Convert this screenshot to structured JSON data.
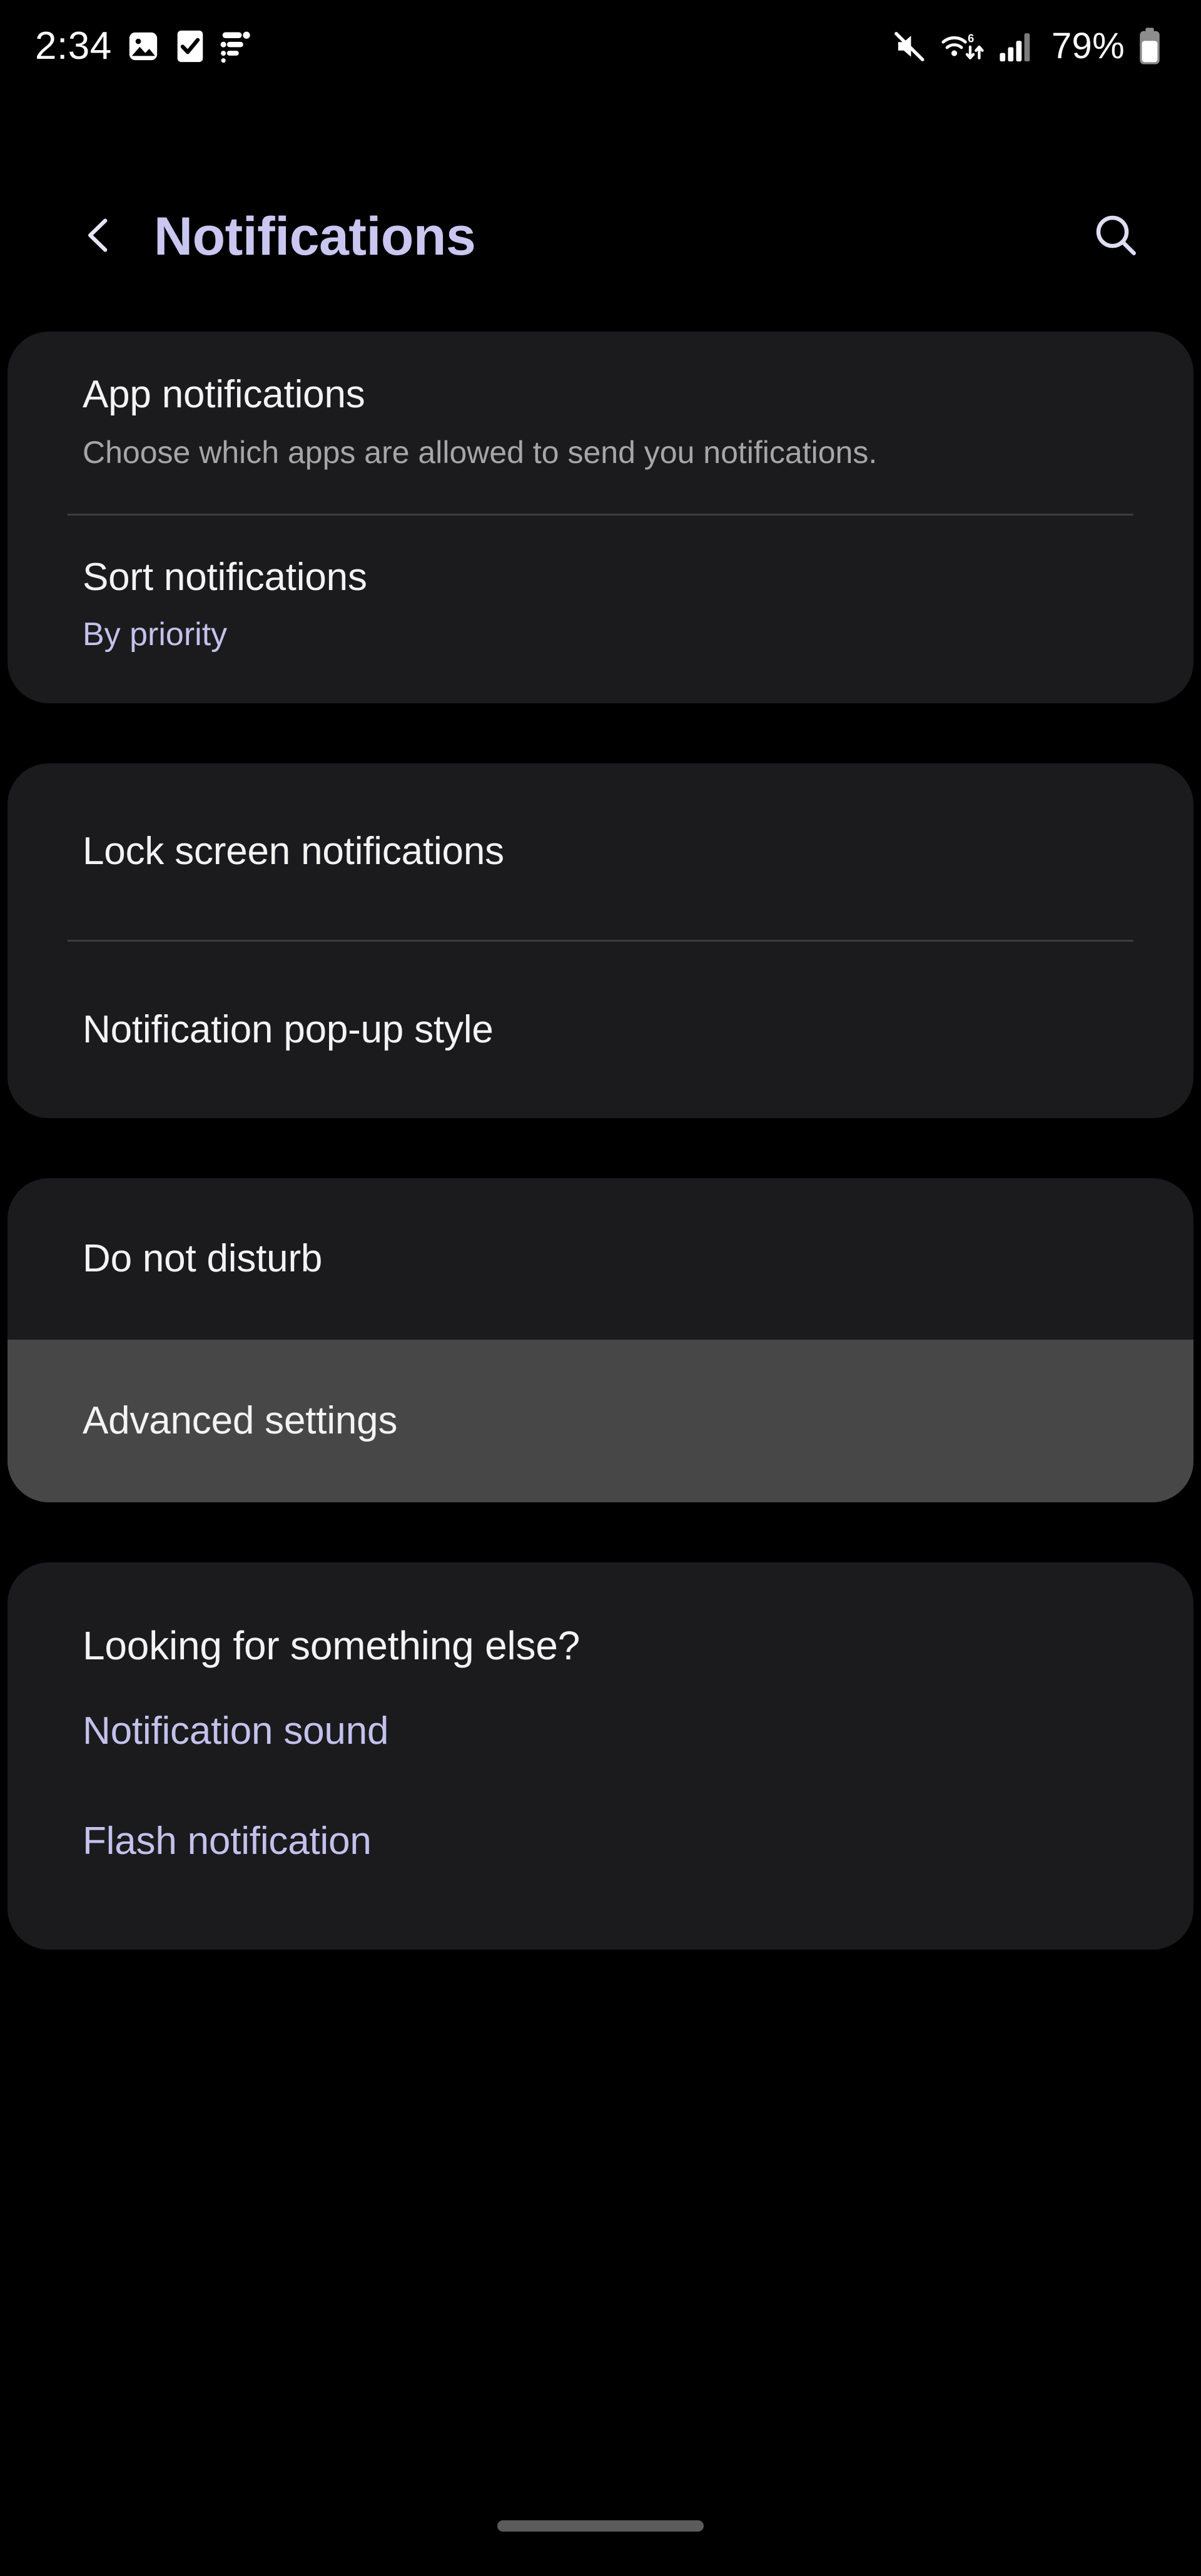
{
  "status_bar": {
    "time": "2:34",
    "battery_percent": "79%",
    "left_icons": [
      "photo-icon",
      "task-checkbox-icon",
      "list-filter-icon"
    ],
    "right_icons": [
      "volume-mute-icon",
      "wifi-6-icon",
      "cellular-signal-icon",
      "battery-icon"
    ],
    "wifi_generation_label": "6"
  },
  "header": {
    "back_icon": "chevron-left-icon",
    "title": "Notifications",
    "search_icon": "search-icon"
  },
  "colors": {
    "background": "#000000",
    "card": "#1b1b1d",
    "highlight": "#474747",
    "accent": "#c3c1ec",
    "title_accent": "#c9c7f0",
    "primary_text": "#f3f3f3",
    "secondary_text": "#a6a6a8",
    "divider": "#3d3d3f",
    "nav_pill": "#5b5b5b"
  },
  "cards": [
    {
      "rows": [
        {
          "title": "App notifications",
          "subtitle": "Choose which apps are allowed to send you notifications."
        },
        {
          "title": "Sort notifications",
          "value": "By priority"
        }
      ]
    },
    {
      "rows": [
        {
          "title": "Lock screen notifications"
        },
        {
          "title": "Notification pop-up style"
        }
      ]
    },
    {
      "rows": [
        {
          "title": "Do not disturb"
        },
        {
          "title": "Advanced settings",
          "highlighted": true
        }
      ]
    },
    {
      "heading": "Looking for something else?",
      "links": [
        {
          "label": "Notification sound"
        },
        {
          "label": "Flash notification"
        }
      ]
    }
  ],
  "nav_bar": {
    "gesture_pill": "home-gesture-pill"
  }
}
